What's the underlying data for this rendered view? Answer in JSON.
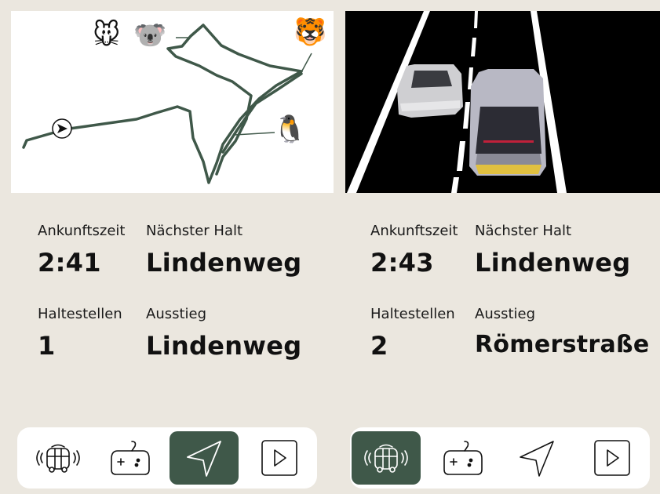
{
  "map": {
    "animals": [
      "mouse-emoji",
      "koala-emoji",
      "tiger-emoji",
      "penguin-emoji"
    ],
    "route_color": "#3f5849"
  },
  "left": {
    "arrival_label": "Ankunftszeit",
    "arrival_value": "2:41",
    "next_stop_label": "Nächster Halt",
    "next_stop_value": "Lindenweg",
    "stops_label": "Haltestellen",
    "stops_value": "1",
    "exit_label": "Ausstieg",
    "exit_value": "Lindenweg"
  },
  "right": {
    "arrival_label": "Ankunftszeit",
    "arrival_value": "2:43",
    "next_stop_label": "Nächster Halt",
    "next_stop_value": "Lindenweg",
    "stops_label": "Haltestellen",
    "stops_value": "2",
    "exit_label": "Ausstieg",
    "exit_value": "Römerstraße"
  },
  "nav_left": {
    "active": "navigation",
    "items": [
      "vehicle-icon",
      "gamepad-icon",
      "navigation-icon",
      "play-icon"
    ]
  },
  "nav_right": {
    "active": "vehicle",
    "items": [
      "vehicle-icon",
      "gamepad-icon",
      "navigation-icon",
      "play-icon"
    ]
  },
  "colors": {
    "accent": "#3f5849",
    "background": "#ebe7df",
    "card": "#ffffff"
  }
}
